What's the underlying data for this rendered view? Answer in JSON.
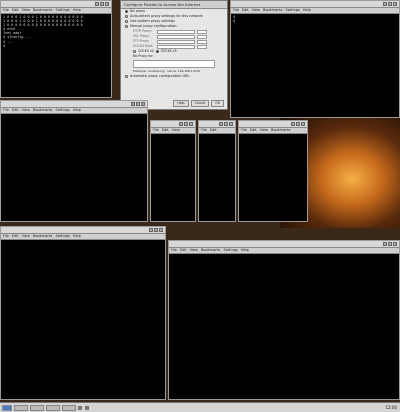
{
  "desktop": {
    "clock": "12:00"
  },
  "menu": [
    "File",
    "Edit",
    "View",
    "Bookmarks",
    "Settings",
    "Help"
  ],
  "proxy_dialog": {
    "title": "Configure Proxies to Access the Internet",
    "options": [
      "No proxy",
      "Auto-detect proxy settings for this network",
      "Use system proxy settings",
      "Manual proxy configuration:"
    ],
    "fields": [
      "HTTP Proxy:",
      "SSL Proxy:",
      "FTP Proxy:",
      "SOCKS Host:"
    ],
    "socks_versions": [
      "SOCKS v4",
      "SOCKS v5"
    ],
    "no_proxy_label": "No Proxy for:",
    "example": "Example: .mozilla.org, .net.nz, 192.168.1.0/24",
    "auto_url": "Automatic proxy configuration URL:",
    "buttons": [
      "Help",
      "Cancel",
      "OK"
    ]
  },
  "windows": {
    "t1": {
      "lines": [
        "1 0 0 0 1 0 0 0 1 0 0 0 0 0 0 0 0 0 0 0",
        "1 0 0 0 1 0 0 0 1 0 0 0 0 0 0 0 0 0 0 0",
        "1 0 0 0 0 0 0 0 0 0 0 0 0 0 0 0 0 0 0 0",
        "",
        "$ eth0 ...",
        "Inet addr",
        "",
        "$ ifconfig ...",
        "",
        "",
        "$ ...",
        "$"
      ]
    },
    "t2": {
      "lines": [
        "",
        "",
        "",
        "",
        "$",
        "",
        "",
        "",
        "",
        "",
        "$"
      ]
    },
    "t3": {
      "lines": [
        "",
        "",
        "",
        "",
        "",
        "",
        "",
        "",
        "",
        "",
        "",
        ""
      ]
    },
    "t4": {
      "lines": [
        "",
        "",
        "",
        "",
        "",
        "",
        "",
        "",
        "",
        "",
        "",
        "",
        "",
        "",
        ""
      ]
    },
    "t5": {
      "lines": [
        "",
        "",
        "",
        "",
        "",
        "",
        "",
        "",
        "",
        "",
        "",
        "",
        ""
      ]
    },
    "t6": {
      "lines": [
        "",
        "",
        "",
        "",
        "",
        "",
        "",
        "",
        "",
        "",
        "",
        "",
        "",
        "",
        "",
        "",
        "",
        "",
        ""
      ]
    },
    "t7": {
      "lines": [
        "",
        "",
        "",
        "",
        "",
        "",
        "",
        "",
        "",
        "",
        "",
        "",
        "",
        "",
        "",
        ""
      ]
    },
    "t8": {
      "lines": [
        "",
        "",
        "",
        "",
        "",
        "",
        "",
        "",
        ""
      ]
    },
    "t9": {
      "lines": [
        "",
        "",
        "",
        "",
        "",
        "",
        "",
        "",
        "",
        "",
        "",
        "",
        "",
        "",
        "",
        "",
        "",
        "",
        "",
        "",
        "",
        "",
        "",
        "",
        "",
        "",
        "",
        "",
        "",
        "",
        ""
      ]
    },
    "t10": {
      "lines": [
        "",
        "",
        "",
        "",
        "",
        "",
        "",
        "",
        "",
        "",
        "",
        "",
        "",
        "",
        "",
        "",
        "",
        "",
        "",
        "",
        "",
        "",
        "",
        "",
        "",
        "",
        "",
        "",
        "",
        "",
        "",
        "",
        "",
        ""
      ]
    }
  }
}
